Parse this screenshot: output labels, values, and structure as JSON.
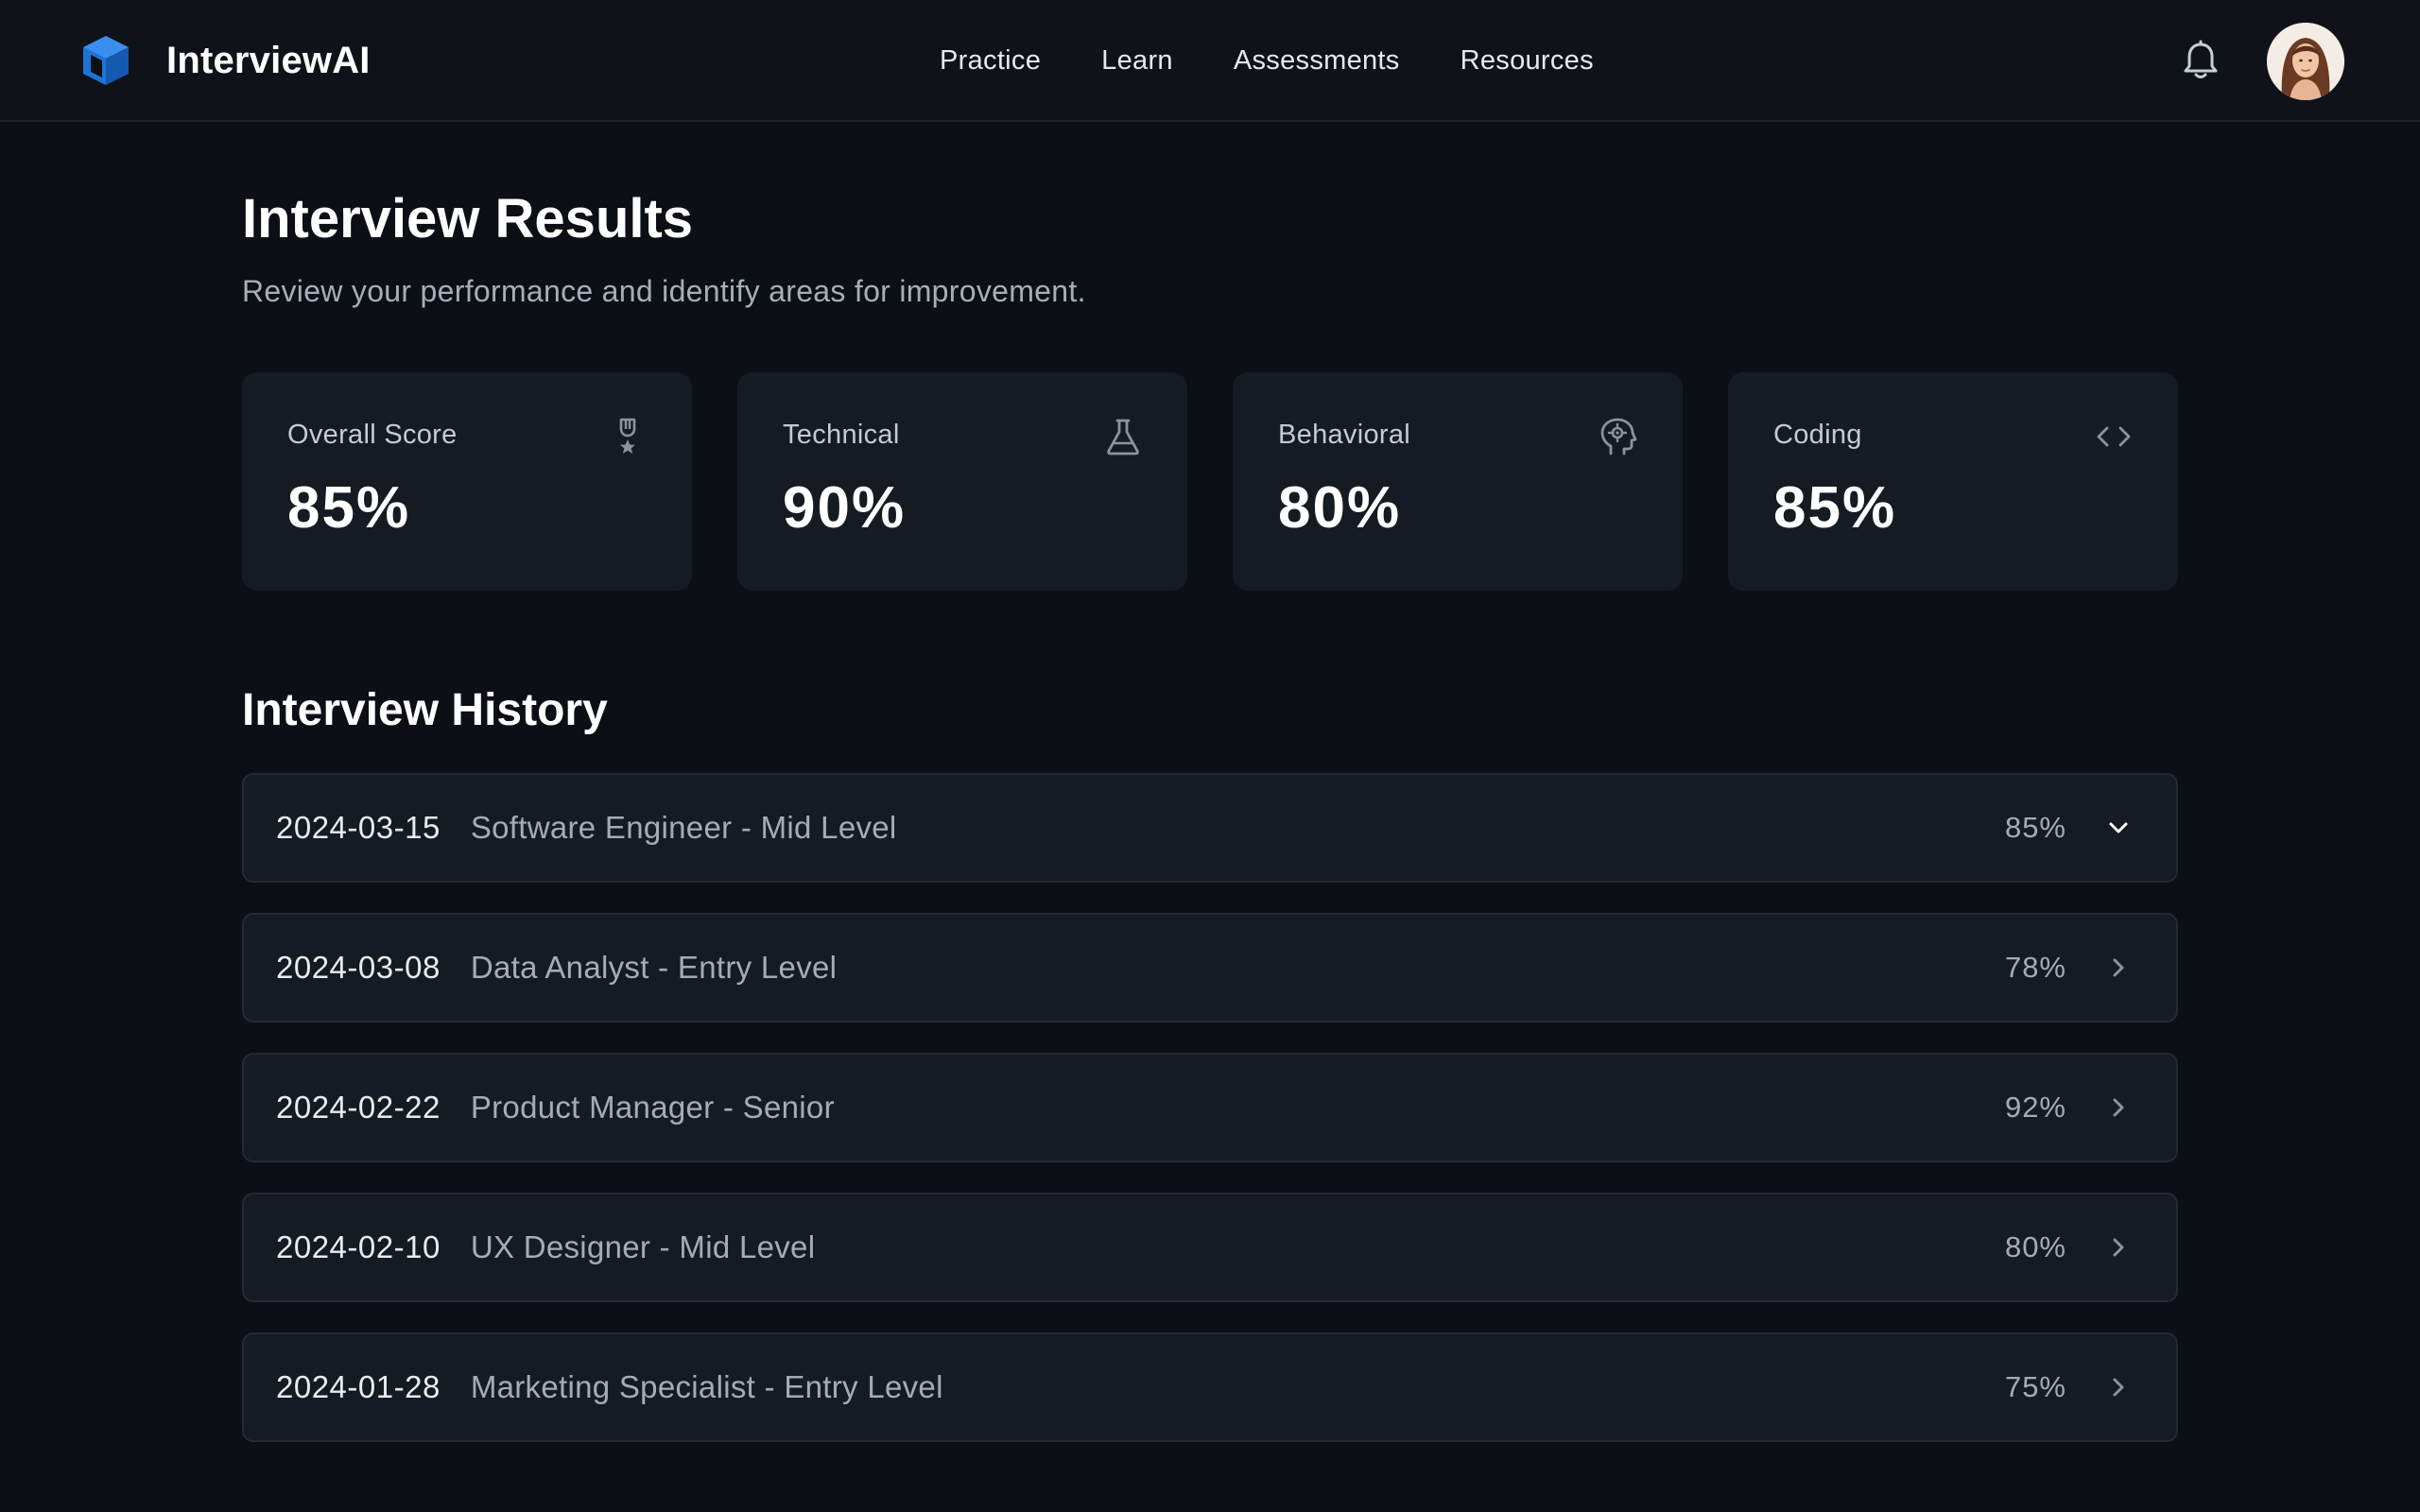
{
  "app": {
    "name": "InterviewAI",
    "accent": "#1d74d8"
  },
  "nav": {
    "items": [
      {
        "label": "Practice"
      },
      {
        "label": "Learn"
      },
      {
        "label": "Assessments"
      },
      {
        "label": "Resources"
      }
    ]
  },
  "header": {
    "notification_icon": "bell-icon",
    "avatar": "user-avatar"
  },
  "page": {
    "title": "Interview Results",
    "subtitle": "Review your performance and identify areas for improvement."
  },
  "scores": [
    {
      "label": "Overall Score",
      "value": "85%",
      "icon": "award-icon"
    },
    {
      "label": "Technical",
      "value": "90%",
      "icon": "flask-icon"
    },
    {
      "label": "Behavioral",
      "value": "80%",
      "icon": "head-gear-icon"
    },
    {
      "label": "Coding",
      "value": "85%",
      "icon": "code-icon"
    }
  ],
  "history": {
    "title": "Interview History",
    "rows": [
      {
        "date": "2024-03-15",
        "role": "Software Engineer - Mid Level",
        "score": "85%",
        "expanded": true
      },
      {
        "date": "2024-03-08",
        "role": "Data Analyst - Entry Level",
        "score": "78%",
        "expanded": false
      },
      {
        "date": "2024-02-22",
        "role": "Product Manager - Senior",
        "score": "92%",
        "expanded": false
      },
      {
        "date": "2024-02-10",
        "role": "UX Designer - Mid Level",
        "score": "80%",
        "expanded": false
      },
      {
        "date": "2024-01-28",
        "role": "Marketing Specialist - Entry Level",
        "score": "75%",
        "expanded": false
      }
    ]
  }
}
